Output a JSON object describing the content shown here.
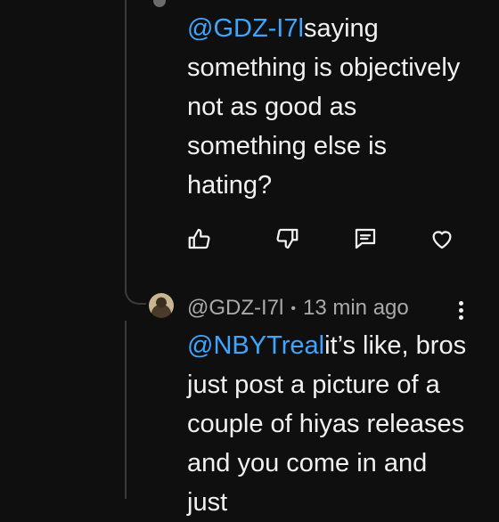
{
  "comments": [
    {
      "mention": "@GDZ-I7l",
      "text": "saying something is objectively not as good as something else is hating?"
    },
    {
      "author": "@GDZ-I7l",
      "time": "13 min ago",
      "mention": "@NBYTreal",
      "text": "it’s like, bros just post a picture of a couple of hiyas releases and you come in and just"
    }
  ],
  "separator": "•",
  "actions": [
    "like-icon",
    "dislike-icon",
    "reply-icon",
    "heart-icon"
  ],
  "colors": {
    "background": "#0f0f0f",
    "text": "#f1f1f1",
    "mention": "#3ea6ff",
    "meta": "#aaaaaa"
  }
}
